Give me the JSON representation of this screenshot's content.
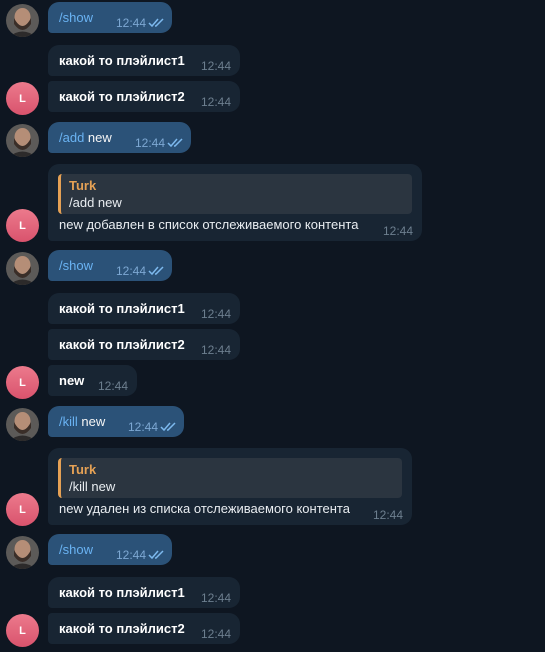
{
  "messages": [
    {
      "cmd": "/show",
      "text": "",
      "time": "12:44"
    },
    {
      "text": "какой то плэйлист1",
      "time": "12:44"
    },
    {
      "text": "какой то плэйлист2",
      "time": "12:44"
    },
    {
      "cmd": "/add",
      "text": " new",
      "time": "12:44"
    },
    {
      "quote_author": "Turk",
      "quote_text": "/add new",
      "text": "new добавлен в список отслеживаемого контента",
      "time": "12:44"
    },
    {
      "cmd": "/show",
      "text": "",
      "time": "12:44"
    },
    {
      "text": "какой то плэйлист1",
      "time": "12:44"
    },
    {
      "text": "какой то плэйлист2",
      "time": "12:44"
    },
    {
      "text": "new",
      "time": "12:44"
    },
    {
      "cmd": "/kill",
      "text": " new",
      "time": "12:44"
    },
    {
      "quote_author": "Turk",
      "quote_text": "/kill new",
      "text": "new удален из списка отслеживаемого контента",
      "time": "12:44"
    },
    {
      "cmd": "/show",
      "text": "",
      "time": "12:44"
    },
    {
      "text": "какой то плэйлист1",
      "time": "12:44"
    },
    {
      "text": "какой то плэйлист2",
      "time": "12:44"
    }
  ],
  "bot_avatar_letter": "L",
  "colors": {
    "background": "#0e1621",
    "outgoing_bubble": "#2b5278",
    "incoming_bubble": "#182533",
    "command_link": "#6ab3f3",
    "quote_accent": "#e5a155",
    "bot_avatar": "#e06279"
  }
}
